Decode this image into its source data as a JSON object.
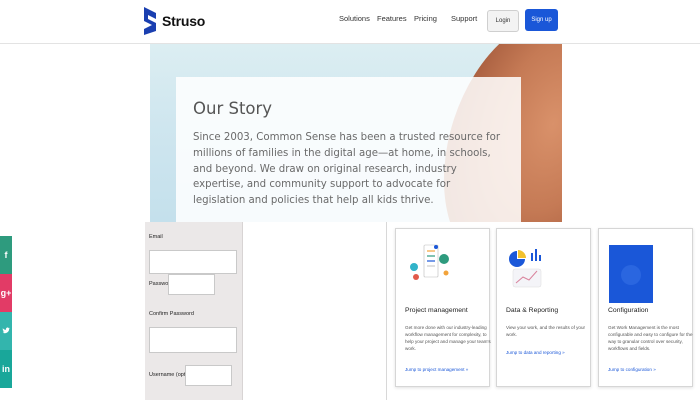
{
  "brand": {
    "name": "Struso",
    "accent": "#1a57d8"
  },
  "nav": {
    "items": [
      "Solutions",
      "Features",
      "Pricing",
      "Support"
    ]
  },
  "auth": {
    "login": "Login",
    "signup": "Sign up"
  },
  "hero": {
    "title": "Our Story",
    "body": "Since 2003, Common Sense has been a trusted resource for millions of families in the digital age—at home, in schools, and beyond. We draw on original research, industry expertise, and community support to advocate for legislation and policies that help all kids thrive."
  },
  "social": {
    "icons": [
      "facebook-icon",
      "google-plus-icon",
      "twitter-icon",
      "linkedin-icon"
    ]
  },
  "form": {
    "email_label": "Email",
    "password_label": "Password",
    "confirm_label": "Confirm Password",
    "username_label": "Username (optional)"
  },
  "cards": [
    {
      "title": "Project management",
      "description": "Get more done with our industry-leading workflow management for complexity, to help your project and manage your team's work.",
      "link": "Jump to project management »"
    },
    {
      "title": "Data & Reporting",
      "description": "View your work, and the results of your work.",
      "link": "Jump to data and reporting »"
    },
    {
      "title": "Configuration",
      "description": "Get Work Management is the most configurable and easy to configure for the way to granular control over security, workflows and fields.",
      "link": "Jump to configuration »"
    }
  ]
}
